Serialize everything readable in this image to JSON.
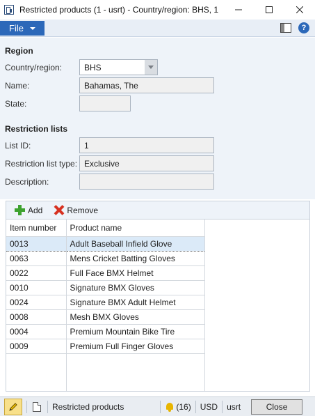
{
  "window": {
    "title": "Restricted products (1 - usrt) - Country/region: BHS, 1",
    "minimize_glyph": "—",
    "maximize_glyph": "☐",
    "close_glyph": "✕"
  },
  "menubar": {
    "file_label": "File",
    "layout_icon": "layout-icon",
    "help_icon": "help-icon",
    "help_glyph": "?"
  },
  "region": {
    "section_title": "Region",
    "country_label": "Country/region:",
    "country_value": "BHS",
    "name_label": "Name:",
    "name_value": "Bahamas, The",
    "state_label": "State:",
    "state_value": ""
  },
  "restriction": {
    "section_title": "Restriction lists",
    "list_id_label": "List ID:",
    "list_id_value": "1",
    "type_label": "Restriction list type:",
    "type_value": "Exclusive",
    "description_label": "Description:",
    "description_value": ""
  },
  "grid": {
    "add_label": "Add",
    "remove_label": "Remove",
    "columns": [
      "Item number",
      "Product name"
    ],
    "rows": [
      {
        "item": "0013",
        "name": "Adult Baseball Infield Glove",
        "selected": true
      },
      {
        "item": "0063",
        "name": "Mens Cricket Batting Gloves",
        "selected": false
      },
      {
        "item": "0022",
        "name": "Full Face BMX Helmet",
        "selected": false
      },
      {
        "item": "0010",
        "name": "Signature BMX Gloves",
        "selected": false
      },
      {
        "item": "0024",
        "name": "Signature BMX Adult Helmet",
        "selected": false
      },
      {
        "item": "0008",
        "name": "Mesh BMX Gloves",
        "selected": false
      },
      {
        "item": "0004",
        "name": "Premium Mountain Bike Tire",
        "selected": false
      },
      {
        "item": "0009",
        "name": "Premium Full Finger Gloves",
        "selected": false
      }
    ]
  },
  "status": {
    "form_name": "Restricted products",
    "notifications": "(16)",
    "currency": "USD",
    "company": "usrt",
    "close_label": "Close"
  },
  "colors": {
    "accent": "#2c68b9",
    "form_background": "#eef3f9",
    "selected_row": "#dbeaf8"
  }
}
